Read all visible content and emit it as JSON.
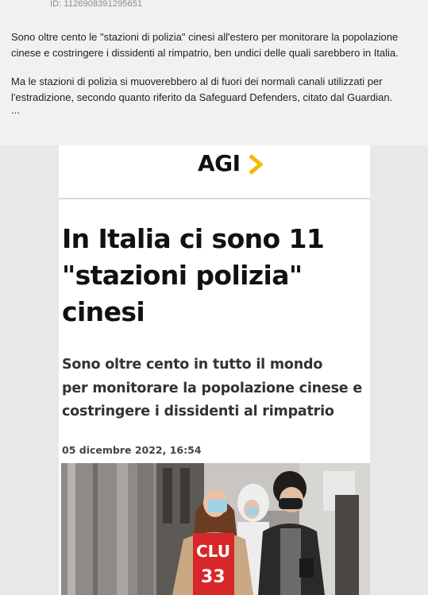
{
  "post": {
    "id_text": "ID: 1126908391295651",
    "paragraph_1": "Sono oltre cento le \"stazioni di polizia\" cinesi all'estero per monitorare la popolazione cinese e costringere i dissidenti al rimpatrio, ben undici delle quali sarebbero in Italia.",
    "paragraph_2": "Ma le stazioni di polizia si muoverebbero al di fuori dei normali canali utilizzati per l'estradizione, secondo quanto riferito da Safeguard Defenders, citato dal Guardian.",
    "ellipsis": "..."
  },
  "article": {
    "logo_text": "AGI",
    "headline_line_1": "In Italia ci sono 11",
    "headline_line_2": "\"stazioni polizia\"",
    "headline_line_3": "cinesi",
    "subtitle_line_1": "Sono oltre cento in tutto il mondo",
    "subtitle_line_2": "per monitorare la popolazione cinese e",
    "subtitle_line_3": "costringere i dissidenti al rimpatrio",
    "date": "05 dicembre 2022, 16:54",
    "photo_shirt_text": "CLU 33"
  },
  "colors": {
    "logo_accent": "#f5b800",
    "shirt": "#d7272a",
    "page_bg": "#f1f1f1"
  },
  "icons": {
    "avatar": "flag-avatar-icon",
    "logo_mark": "chevron-right-icon"
  }
}
